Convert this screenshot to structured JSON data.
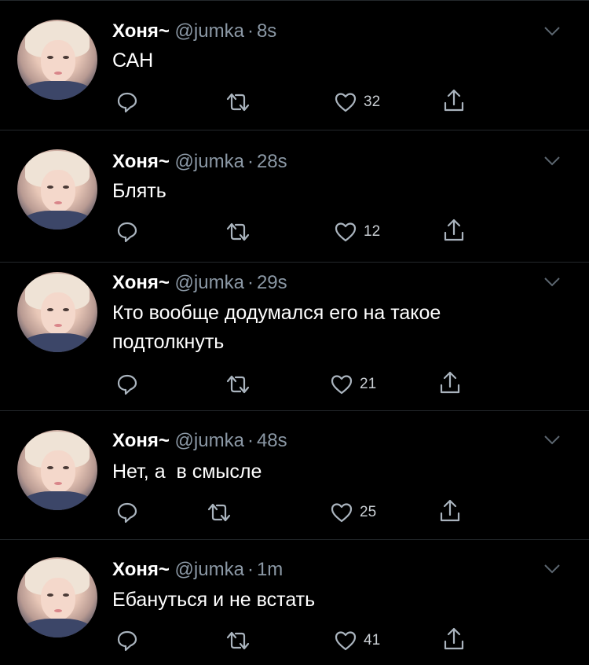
{
  "tweets": [
    {
      "name": "Хоня~",
      "handle": "@jumka",
      "separator": "·",
      "time": "8s",
      "text": "САН",
      "likes": "32"
    },
    {
      "name": "Хоня~",
      "handle": "@jumka",
      "separator": "·",
      "time": "28s",
      "text": "Блять",
      "likes": "12"
    },
    {
      "name": "Хоня~",
      "handle": "@jumka",
      "separator": "·",
      "time": "29s",
      "text": "Кто вообще додумался его на такое подтолкнуть",
      "likes": "21"
    },
    {
      "name": "Хоня~",
      "handle": "@jumka",
      "separator": "·",
      "time": "48s",
      "text": "Нет, а  в смысле",
      "likes": "25"
    },
    {
      "name": "Хоня~",
      "handle": "@jumka",
      "separator": "·",
      "time": "1m",
      "text": "Ебануться и не встать",
      "likes": "41"
    }
  ],
  "icons": {
    "reply": "reply-icon",
    "retweet": "retweet-icon",
    "like": "heart-icon",
    "share": "share-icon",
    "menu": "chevron-down-icon"
  },
  "colors": {
    "background": "#000000",
    "text": "#ffffff",
    "muted": "#8b98a5",
    "divider": "#24282c"
  }
}
